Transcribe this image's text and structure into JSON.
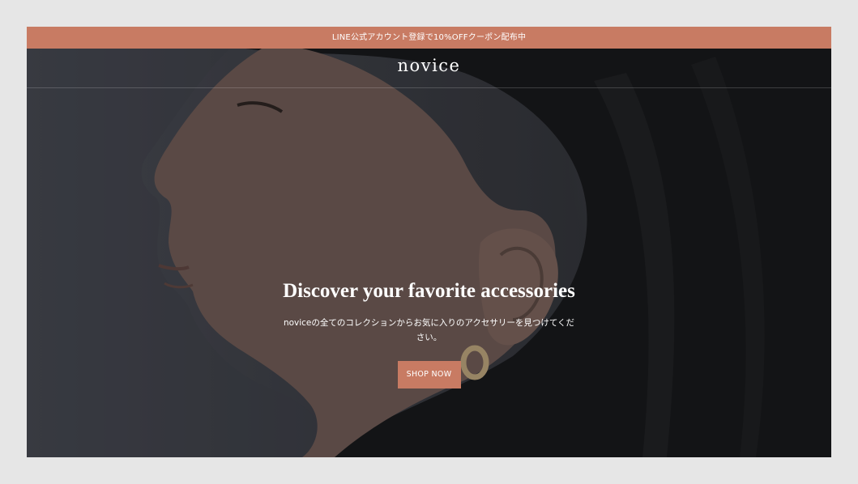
{
  "announcement": {
    "text": "LINE公式アカウント登録で10%OFFクーポン配布中"
  },
  "header": {
    "logo": "novice"
  },
  "hero": {
    "headline": "Discover your favorite accessories",
    "subtext": "noviceの全てのコレクションからお気に入りのアクセサリーを見つけてください。",
    "cta_label": "SHOP NOW"
  },
  "colors": {
    "accent": "#c87b63",
    "page_background": "#e6e6e6"
  }
}
